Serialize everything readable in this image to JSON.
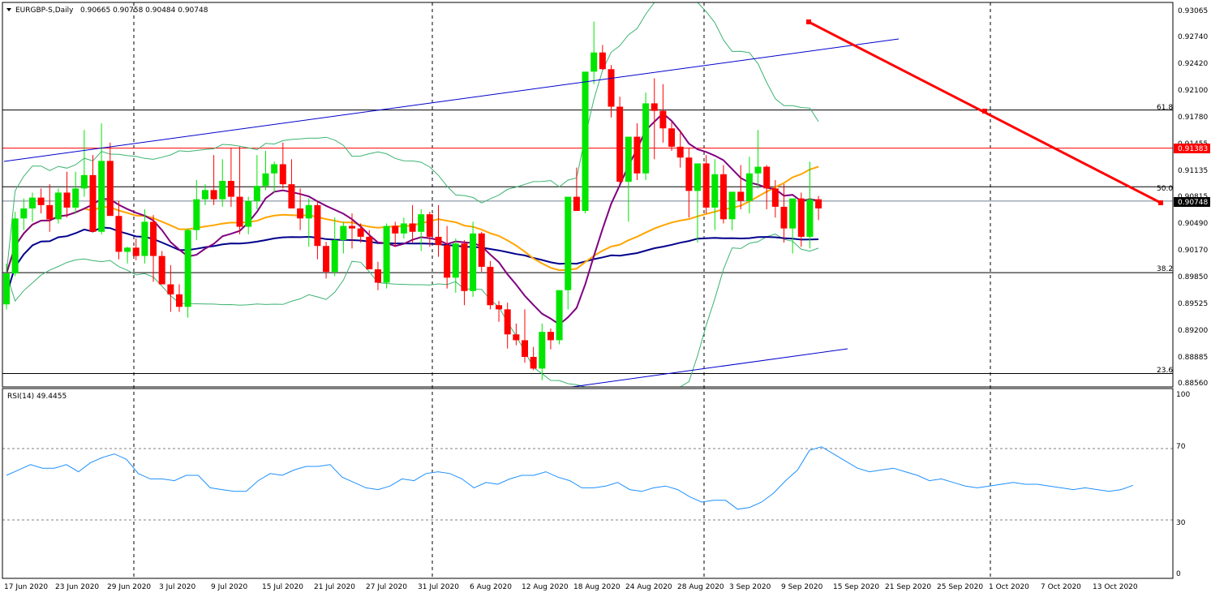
{
  "header": {
    "symbol_title": "EURGBP-S,Daily",
    "ohlc": "0.90665 0.90758 0.90484 0.90748"
  },
  "rsi_panel": {
    "title": "RSI(14) 49.4455",
    "levels": [
      "100",
      "70",
      "30",
      "0"
    ]
  },
  "price_axis": {
    "ticks": [
      "0.93065",
      "0.92740",
      "0.92420",
      "0.92100",
      "0.91780",
      "0.91455",
      "0.91135",
      "0.90815",
      "0.90490",
      "0.90170",
      "0.89850",
      "0.89525",
      "0.89200",
      "0.88885",
      "0.88560"
    ],
    "current_price_label": "0.90748",
    "red_level_label": "0.91383"
  },
  "fib_labels": {
    "f618": "61.8",
    "f50": "50.0",
    "f382": "38.2",
    "f236": "23.6"
  },
  "date_axis": {
    "labels": [
      "17 Jun 2020",
      "23 Jun 2020",
      "29 Jun 2020",
      "3 Jul 2020",
      "9 Jul 2020",
      "15 Jul 2020",
      "21 Jul 2020",
      "27 Jul 2020",
      "31 Jul 2020",
      "6 Aug 2020",
      "12 Aug 2020",
      "18 Aug 2020",
      "24 Aug 2020",
      "28 Aug 2020",
      "3 Sep 2020",
      "9 Sep 2020",
      "15 Sep 2020",
      "21 Sep 2020",
      "25 Sep 2020",
      "1 Oct 2020",
      "7 Oct 2020",
      "13 Oct 2020"
    ]
  },
  "colors": {
    "bull": "#00e600",
    "bear": "#ff0000",
    "bollinger": "#3cb371",
    "ma_fast": "#800080",
    "ma_mid": "#ffa500",
    "ma_slow": "#00008b",
    "rsi": "#1e90ff",
    "trendline_red": "#ff0000",
    "channel_blue": "#0000cd",
    "background": "#ffffff"
  },
  "chart_data": {
    "type": "candlestick",
    "symbol": "EURGBP-S",
    "timeframe": "Daily",
    "ylim": [
      0.8852,
      0.9313
    ],
    "x_categories": [
      "17 Jun 2020",
      "23 Jun 2020",
      "29 Jun 2020",
      "3 Jul 2020",
      "9 Jul 2020",
      "15 Jul 2020",
      "21 Jul 2020",
      "27 Jul 2020",
      "31 Jul 2020",
      "6 Aug 2020",
      "12 Aug 2020",
      "18 Aug 2020",
      "24 Aug 2020",
      "28 Aug 2020",
      "3 Sep 2020",
      "9 Sep 2020",
      "15 Sep 2020",
      "21 Sep 2020",
      "25 Sep 2020",
      "1 Oct 2020",
      "7 Oct 2020",
      "13 Oct 2020"
    ],
    "candles": [
      [
        0.8951,
        0.9,
        0.8945,
        0.8988
      ],
      [
        0.8988,
        0.9062,
        0.8985,
        0.9054
      ],
      [
        0.9054,
        0.9078,
        0.904,
        0.9066
      ],
      [
        0.9066,
        0.9085,
        0.905,
        0.9079
      ],
      [
        0.9079,
        0.909,
        0.906,
        0.907
      ],
      [
        0.907,
        0.9095,
        0.9038,
        0.9053
      ],
      [
        0.9053,
        0.909,
        0.9048,
        0.9085
      ],
      [
        0.9085,
        0.911,
        0.9055,
        0.9067
      ],
      [
        0.9067,
        0.911,
        0.906,
        0.909
      ],
      [
        0.909,
        0.916,
        0.908,
        0.9106
      ],
      [
        0.9106,
        0.913,
        0.904,
        0.9038
      ],
      [
        0.9038,
        0.9168,
        0.9035,
        0.9123
      ],
      [
        0.9123,
        0.9145,
        0.9062,
        0.9057
      ],
      [
        0.9057,
        0.9075,
        0.9005,
        0.9014
      ],
      [
        0.9014,
        0.902,
        0.9,
        0.9019
      ],
      [
        0.9019,
        0.903,
        0.9004,
        0.9009
      ],
      [
        0.9009,
        0.9065,
        0.9,
        0.905
      ],
      [
        0.905,
        0.9058,
        0.8978,
        0.9009
      ],
      [
        0.9009,
        0.9015,
        0.8975,
        0.8975
      ],
      [
        0.8975,
        0.8998,
        0.8942,
        0.8963
      ],
      [
        0.8963,
        0.8975,
        0.8942,
        0.8948
      ],
      [
        0.8948,
        0.9042,
        0.8935,
        0.904
      ],
      [
        0.904,
        0.91,
        0.9028,
        0.9077
      ],
      [
        0.9077,
        0.9095,
        0.907,
        0.9088
      ],
      [
        0.9088,
        0.913,
        0.907,
        0.9077
      ],
      [
        0.9077,
        0.9125,
        0.9068,
        0.9099
      ],
      [
        0.9099,
        0.9139,
        0.9068,
        0.908
      ],
      [
        0.908,
        0.914,
        0.9035,
        0.9044
      ],
      [
        0.9044,
        0.908,
        0.9035,
        0.9075
      ],
      [
        0.9075,
        0.913,
        0.9065,
        0.9093
      ],
      [
        0.9093,
        0.9135,
        0.9088,
        0.9108
      ],
      [
        0.9108,
        0.9122,
        0.9085,
        0.9119
      ],
      [
        0.9119,
        0.9145,
        0.909,
        0.9095
      ],
      [
        0.9095,
        0.9125,
        0.9066,
        0.9066
      ],
      [
        0.9066,
        0.909,
        0.904,
        0.9054
      ],
      [
        0.9054,
        0.9078,
        0.902,
        0.907
      ],
      [
        0.907,
        0.9075,
        0.9005,
        0.9021
      ],
      [
        0.9021,
        0.9026,
        0.8982,
        0.899
      ],
      [
        0.899,
        0.9055,
        0.8985,
        0.9028
      ],
      [
        0.9028,
        0.905,
        0.9012,
        0.9045
      ],
      [
        0.9045,
        0.906,
        0.9018,
        0.9042
      ],
      [
        0.9042,
        0.9048,
        0.9025,
        0.9032
      ],
      [
        0.9032,
        0.904,
        0.9,
        0.8993
      ],
      [
        0.8993,
        0.9002,
        0.8968,
        0.8977
      ],
      [
        0.8977,
        0.9048,
        0.897,
        0.9045
      ],
      [
        0.9045,
        0.905,
        0.902,
        0.9036
      ],
      [
        0.9036,
        0.9055,
        0.903,
        0.9048
      ],
      [
        0.9048,
        0.907,
        0.9025,
        0.9038
      ],
      [
        0.9038,
        0.9065,
        0.9015,
        0.9059
      ],
      [
        0.9059,
        0.9062,
        0.902,
        0.9032
      ],
      [
        0.9032,
        0.907,
        0.9008,
        0.9022
      ],
      [
        0.9022,
        0.9045,
        0.897,
        0.8983
      ],
      [
        0.8983,
        0.903,
        0.8965,
        0.9024
      ],
      [
        0.9024,
        0.9028,
        0.895,
        0.8967
      ],
      [
        0.8967,
        0.905,
        0.896,
        0.9036
      ],
      [
        0.9036,
        0.9038,
        0.899,
        0.8996
      ],
      [
        0.8996,
        0.9003,
        0.8945,
        0.895
      ],
      [
        0.895,
        0.8955,
        0.893,
        0.8945
      ],
      [
        0.8945,
        0.8953,
        0.8898,
        0.8915
      ],
      [
        0.8915,
        0.8928,
        0.8902,
        0.8908
      ],
      [
        0.8908,
        0.8945,
        0.8881,
        0.8888
      ],
      [
        0.8888,
        0.89,
        0.8872,
        0.8874
      ],
      [
        0.8874,
        0.8928,
        0.886,
        0.8918
      ],
      [
        0.8918,
        0.8922,
        0.8897,
        0.8908
      ],
      [
        0.8908,
        0.8955,
        0.8903,
        0.8968
      ],
      [
        0.8968,
        0.906,
        0.8945,
        0.908
      ],
      [
        0.908,
        0.9115,
        0.9065,
        0.9063
      ],
      [
        0.9063,
        0.915,
        0.906,
        0.923
      ],
      [
        0.923,
        0.929,
        0.9215,
        0.9253
      ],
      [
        0.9253,
        0.9262,
        0.9232,
        0.9233
      ],
      [
        0.9233,
        0.9238,
        0.9175,
        0.9188
      ],
      [
        0.9188,
        0.92,
        0.9095,
        0.9098
      ],
      [
        0.9098,
        0.9105,
        0.905,
        0.9152
      ],
      [
        0.9152,
        0.9168,
        0.91,
        0.9108
      ],
      [
        0.9108,
        0.9205,
        0.91,
        0.9192
      ],
      [
        0.9192,
        0.9222,
        0.9125,
        0.9183
      ],
      [
        0.9183,
        0.9215,
        0.9145,
        0.9162
      ],
      [
        0.9162,
        0.917,
        0.9135,
        0.914
      ],
      [
        0.914,
        0.916,
        0.9115,
        0.9127
      ],
      [
        0.9127,
        0.9138,
        0.9055,
        0.9087
      ],
      [
        0.9087,
        0.912,
        0.9025,
        0.912
      ],
      [
        0.912,
        0.913,
        0.906,
        0.9067
      ],
      [
        0.9067,
        0.9125,
        0.904,
        0.9107
      ],
      [
        0.9107,
        0.9118,
        0.9048,
        0.9053
      ],
      [
        0.9053,
        0.9085,
        0.904,
        0.9086
      ],
      [
        0.9086,
        0.9118,
        0.9065,
        0.9075
      ],
      [
        0.9075,
        0.9128,
        0.906,
        0.9108
      ],
      [
        0.9108,
        0.916,
        0.909,
        0.9116
      ],
      [
        0.9116,
        0.9118,
        0.9065,
        0.909
      ],
      [
        0.909,
        0.91,
        0.9055,
        0.9068
      ],
      [
        0.9068,
        0.9095,
        0.9025,
        0.9042
      ],
      [
        0.9042,
        0.907,
        0.9012,
        0.9078
      ],
      [
        0.9078,
        0.9085,
        0.902,
        0.9032
      ],
      [
        0.9032,
        0.9122,
        0.9018,
        0.9077
      ],
      [
        0.9077,
        0.9081,
        0.9052,
        0.9066
      ]
    ],
    "indicators": {
      "bollinger_bands_visible": true,
      "moving_averages_visible": true
    },
    "horizontal_levels": [
      {
        "label": "61.8",
        "value": 0.9184
      },
      {
        "label": "",
        "value": 0.91383
      },
      {
        "label": "50.0",
        "value": 0.9092
      },
      {
        "label": "38.2",
        "value": 0.8989
      },
      {
        "label": "23.6",
        "value": 0.8868
      }
    ],
    "current_price": 0.90748,
    "rsi": {
      "period": 14,
      "last": 49.4455,
      "ylim": [
        0,
        100
      ],
      "levels": [
        30,
        70
      ],
      "values": [
        55,
        58,
        61,
        59,
        59,
        61,
        57,
        62,
        65,
        67,
        64,
        56,
        53,
        53,
        52,
        55,
        55,
        48,
        47,
        46,
        46,
        52,
        56,
        55,
        58,
        60,
        60,
        61,
        54,
        51,
        48,
        47,
        49,
        53,
        52,
        56,
        57,
        56,
        53,
        48,
        51,
        50,
        53,
        55,
        55,
        57,
        54,
        52,
        48,
        48,
        49,
        51,
        47,
        46,
        48,
        49,
        47,
        43,
        40,
        41,
        41,
        36,
        37,
        40,
        45,
        52,
        58,
        69,
        71,
        67,
        63,
        59,
        57,
        58,
        59,
        57,
        55,
        52,
        53,
        51,
        49,
        48,
        49,
        50,
        51,
        50,
        50,
        49,
        48,
        47,
        48,
        47,
        46,
        47,
        49.4
      ]
    }
  }
}
